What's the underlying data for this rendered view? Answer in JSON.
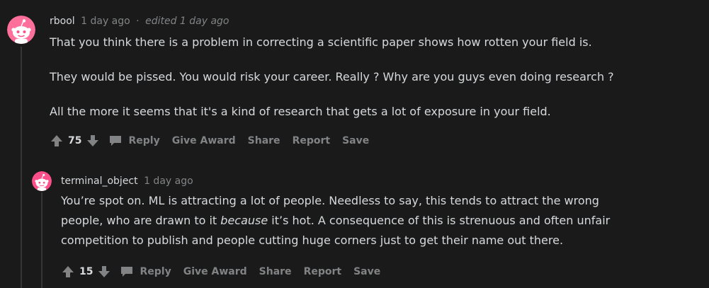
{
  "colors": {
    "background": "#1a1a1b",
    "text": "#d7dadc",
    "muted": "#818384",
    "avatar_bg_1": "#ff6f9c",
    "avatar_bg_2": "#ff4f8b"
  },
  "comment": {
    "author": "rbool",
    "time": "1 day ago",
    "separator": "·",
    "edited": "edited 1 day ago",
    "paragraphs": [
      "That you think there is a problem in correcting a scientific paper shows how rotten your field is.",
      "They would be pissed. You would risk your career. Really ? Why are you guys even doing research ?",
      "All the more it seems that it's a kind of research that gets a lot of exposure in your field."
    ],
    "score": "75",
    "actions": {
      "reply": "Reply",
      "give_award": "Give Award",
      "share": "Share",
      "report": "Report",
      "save": "Save"
    }
  },
  "reply": {
    "author": "terminal_object",
    "time": "1 day ago",
    "lines": {
      "l1": "You’re spot on. ML is attracting a lot of people. Needless to say, this tends to attract the wrong",
      "l2_pre": "people, who are drawn to it ",
      "l2_em": "because",
      "l2_post": " it’s hot. A consequence of this is strenuous and often unfair",
      "l3": "competition to publish and people cutting huge corners just to get their name out there."
    },
    "score": "15",
    "actions": {
      "reply": "Reply",
      "give_award": "Give Award",
      "share": "Share",
      "report": "Report",
      "save": "Save"
    }
  }
}
